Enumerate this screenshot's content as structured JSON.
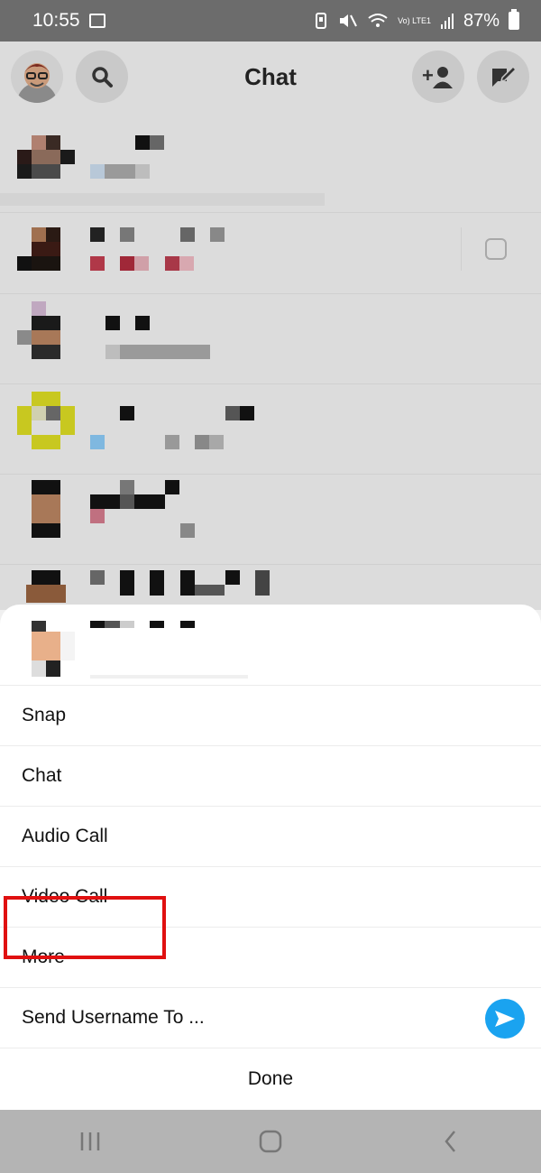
{
  "status_bar": {
    "time": "10:55",
    "network_label": "Vo) LTE1",
    "battery": "87%"
  },
  "header": {
    "title": "Chat"
  },
  "sheet": {
    "items": [
      {
        "label": "Snap"
      },
      {
        "label": "Chat"
      },
      {
        "label": "Audio Call"
      },
      {
        "label": "Video Call"
      },
      {
        "label": "More"
      },
      {
        "label": "Send Username To ..."
      }
    ],
    "done_label": "Done"
  },
  "colors": {
    "highlight": "#e01010",
    "send_icon": "#1aa3f0",
    "dim_overlay": "#dcdcdc"
  },
  "icons": {
    "search": "search-icon",
    "add_friend": "add-friend-icon",
    "new_chat": "new-chat-icon",
    "send": "send-arrow-icon"
  }
}
